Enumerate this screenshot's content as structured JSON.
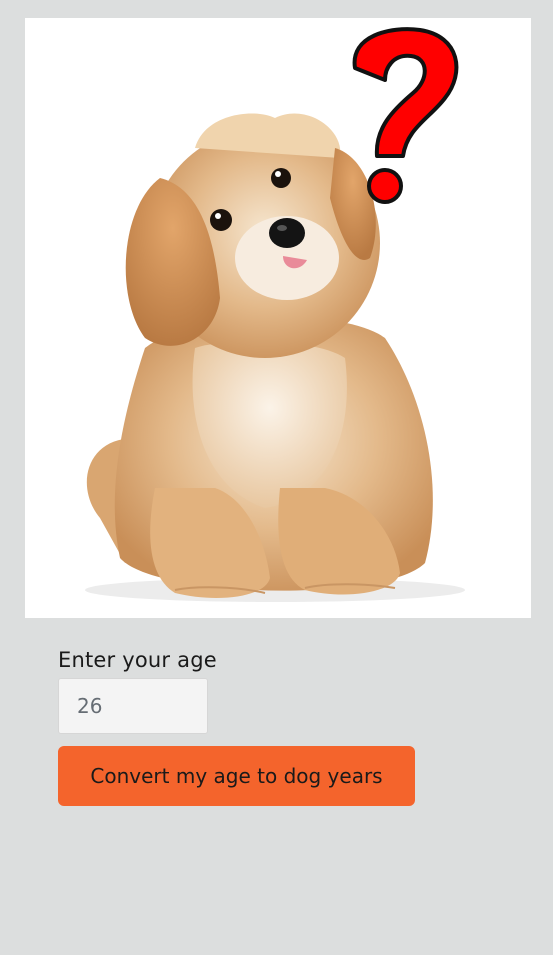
{
  "form": {
    "age_label": "Enter your age",
    "age_value": "26",
    "button_label": "Convert my age to dog years"
  },
  "colors": {
    "page_background": "#dcdede",
    "button": "#f4642c",
    "question_mark": "#ff0000"
  },
  "hero": {
    "icon": "puppy-with-question-mark"
  }
}
